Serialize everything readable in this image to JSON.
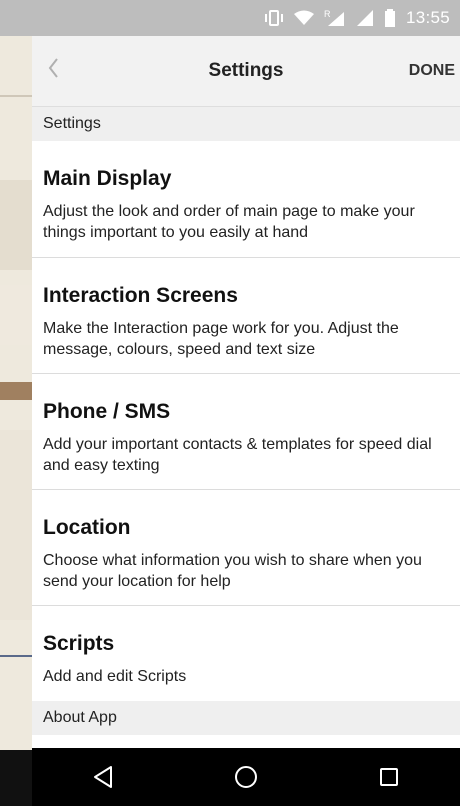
{
  "status_bar": {
    "time": "13:55",
    "network_badge": "R"
  },
  "nav": {
    "back_icon": "chevron-left-icon",
    "title": "Settings",
    "done_label": "DONE"
  },
  "sections": {
    "settings_header": "Settings",
    "about_header": "About App"
  },
  "items": [
    {
      "title": "Main Display",
      "description": "Adjust the look and order of main page to make your things important to you easily at hand"
    },
    {
      "title": "Interaction Screens",
      "description": "Make the Interaction page work for you. Adjust the message, colours, speed and text size"
    },
    {
      "title": "Phone / SMS",
      "description": "Add your important contacts & templates for speed dial and easy texting"
    },
    {
      "title": "Location",
      "description": "Choose what information you wish to share when you send your location for help"
    },
    {
      "title": "Scripts",
      "description": "Add and edit Scripts"
    }
  ],
  "system_nav": {
    "back": "back-triangle-icon",
    "home": "home-circle-icon",
    "recents": "recents-square-icon"
  },
  "colors": {
    "status_bar": "#bdbdbd",
    "nav_bar": "#f2f2f2",
    "section_header": "#efefef",
    "system_nav": "#000000"
  }
}
